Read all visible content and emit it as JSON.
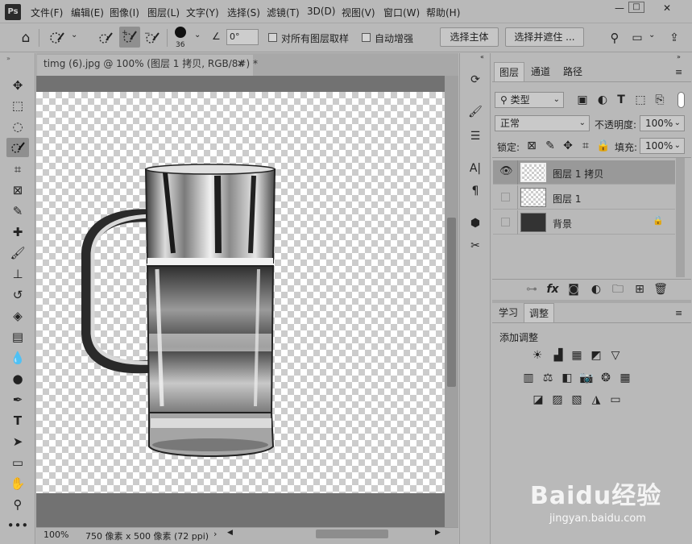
{
  "app": {
    "logo": "Ps"
  },
  "menu": [
    "文件(F)",
    "编辑(E)",
    "图像(I)",
    "图层(L)",
    "文字(Y)",
    "选择(S)",
    "滤镜(T)",
    "3D(D)",
    "视图(V)",
    "窗口(W)",
    "帮助(H)"
  ],
  "window_controls": {
    "minimize": "—",
    "maximize": "□",
    "close": "✕"
  },
  "options": {
    "brush_size": "36",
    "angle": "0°",
    "sample_all_layers": "对所有图层取样",
    "auto_enhance": "自动增强",
    "select_subject": "选择主体",
    "select_and_mask": "选择并遮住 ..."
  },
  "document": {
    "tab_title": "timg (6).jpg @ 100% (图层 1 拷贝, RGB/8#) *",
    "zoom": "100%",
    "status_info": "750 像素 x 500 像素 (72 ppi)"
  },
  "layers_panel": {
    "tabs": [
      "图层",
      "通道",
      "路径"
    ],
    "filter_type": "类型",
    "blend_mode": "正常",
    "opacity_label": "不透明度:",
    "opacity_value": "100%",
    "lock_label": "锁定:",
    "fill_label": "填充:",
    "fill_value": "100%",
    "layers": [
      {
        "name": "图层 1 拷贝",
        "visible": true,
        "selected": true,
        "locked": false
      },
      {
        "name": "图层 1",
        "visible": false,
        "selected": false,
        "locked": false
      },
      {
        "name": "背景",
        "visible": false,
        "selected": false,
        "locked": true
      }
    ]
  },
  "adjust_panel": {
    "tabs": [
      "学习",
      "调整"
    ],
    "heading": "添加调整"
  },
  "watermark": {
    "brand": "Baidu经验",
    "url": "jingyan.baidu.com"
  },
  "colors": {
    "accent_dark": "#2b2b2b",
    "canvas_bg": "#727272",
    "selected_layer": "#999999"
  }
}
